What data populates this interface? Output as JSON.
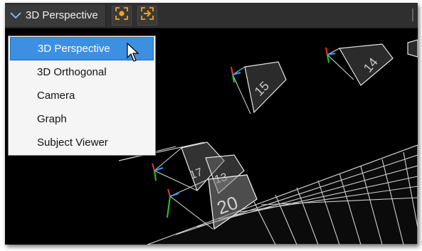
{
  "toolbar": {
    "view_label": "3D Perspective",
    "view_icon": "chevron-down-icon",
    "buttons": [
      {
        "icon": "camera-focus-icon",
        "color": "#f2a521"
      },
      {
        "icon": "arrow-enter-icon",
        "color": "#f2a521"
      }
    ]
  },
  "menu": {
    "items": [
      {
        "label": "3D Perspective",
        "selected": true
      },
      {
        "label": "3D Orthogonal",
        "selected": false
      },
      {
        "label": "Camera",
        "selected": false
      },
      {
        "label": "Graph",
        "selected": false
      },
      {
        "label": "Subject Viewer",
        "selected": false
      }
    ],
    "selection_color": "#3d8fe2"
  },
  "scene": {
    "camera_labels": [
      "15",
      "14",
      "20",
      "17",
      "13"
    ]
  },
  "colors": {
    "toolbar_bg": "#2f2f2f",
    "viewport_bg": "#000000",
    "accent": "#f2a521"
  }
}
